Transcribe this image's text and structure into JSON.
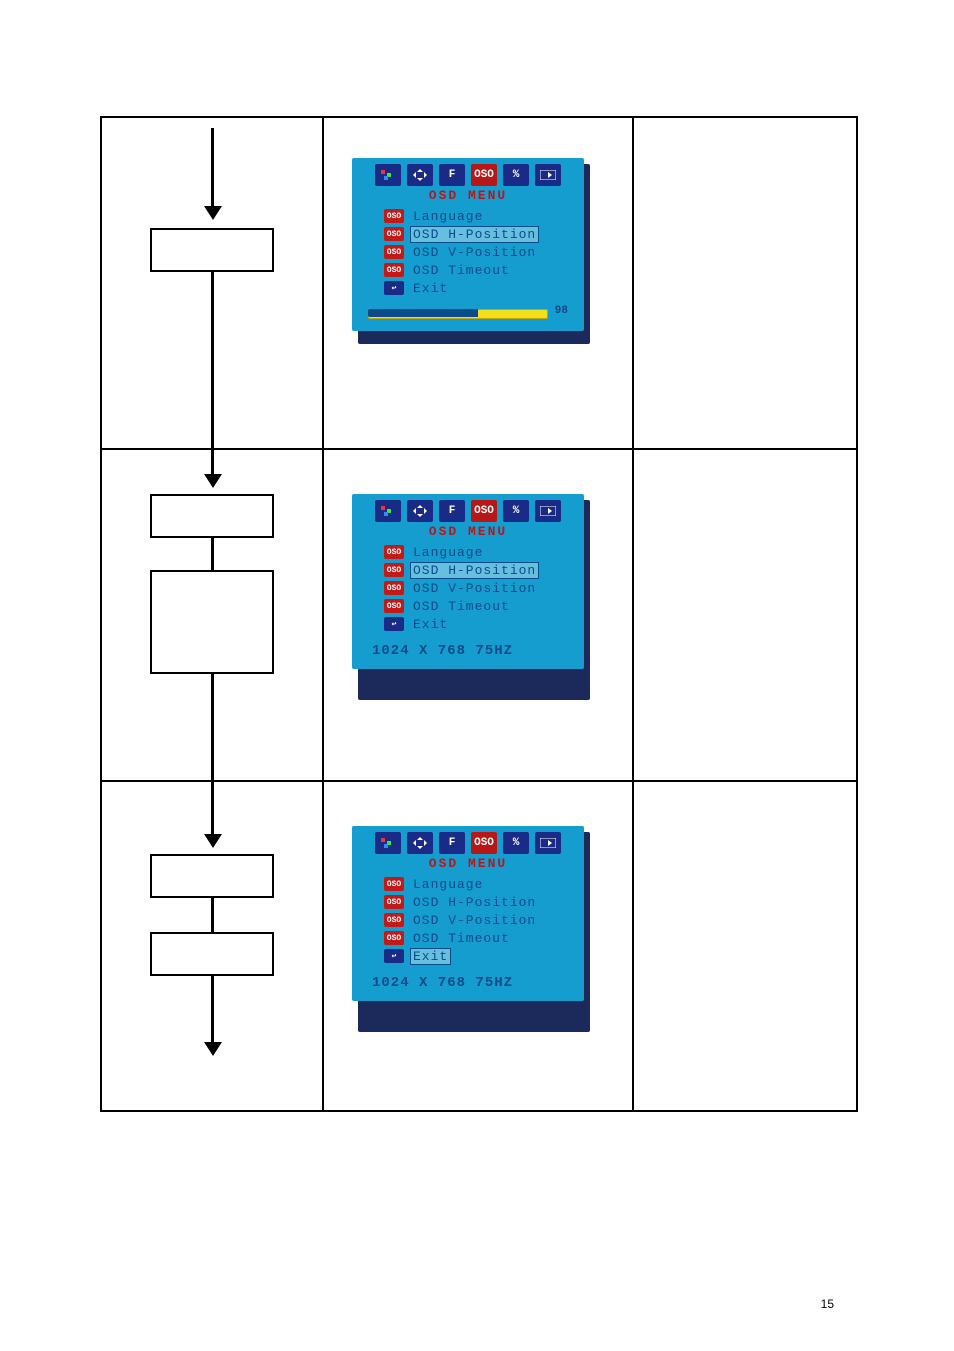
{
  "page_number": "15",
  "osd_common": {
    "title": "OSD  MENU",
    "items": {
      "language": "Language",
      "hpos": "OSD H-Position",
      "vpos": "OSD V-Position",
      "timeout": "OSD Timeout",
      "exit": "Exit"
    },
    "icons": {
      "badge_osd": "OSO",
      "exit_glyph": "↩"
    },
    "topbar": [
      "color",
      "position",
      "F",
      "OSO",
      "pct",
      "exit"
    ]
  },
  "row1": {
    "slider_value": "98",
    "slider_fill_pct": 55,
    "selected": "hpos"
  },
  "row2": {
    "footer": "1024 X 768 75HZ",
    "selected": "hpos"
  },
  "row3": {
    "footer": "1024 X 768 75HZ",
    "selected": "exit"
  }
}
